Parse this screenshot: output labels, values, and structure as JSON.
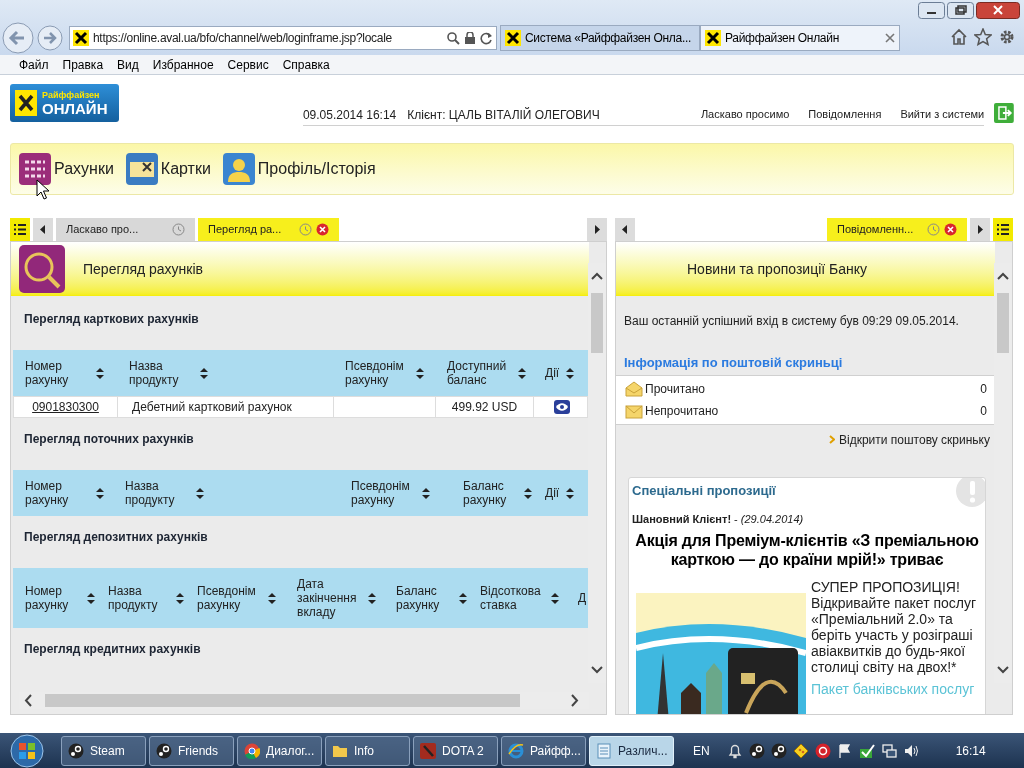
{
  "browser": {
    "address": "https://online.aval.ua/bfo/channel/web/loginframe.jsp?locale",
    "tabs": [
      {
        "label": "Система «Райффайзен Онла...",
        "selected": false
      },
      {
        "label": "Райффайзен Онлайн",
        "selected": true
      }
    ],
    "menu": [
      "Файл",
      "Правка",
      "Вид",
      "Избранное",
      "Сервис",
      "Справка"
    ]
  },
  "logo": {
    "line1": "Райффайзен",
    "line2": "ОНЛАЙН"
  },
  "header": {
    "date": "09.05.2014 16:14",
    "client": "Клієнт: ЦАЛЬ ВІТАЛІЙ ОЛЕГОВИЧ",
    "links": [
      "Ласкаво просимо",
      "Повідомлення",
      "Вийти з системи"
    ]
  },
  "nav": [
    {
      "label": "Рахунки",
      "kind": "accounts"
    },
    {
      "label": "Картки",
      "kind": "cards"
    },
    {
      "label": "Профіль/Історія",
      "kind": "profile"
    }
  ],
  "left_panel": {
    "tabs": [
      {
        "label": "Ласкаво про...",
        "selected": false
      },
      {
        "label": "Перегляд ра...",
        "selected": true
      }
    ],
    "title": "Перегляд рахунків",
    "sections": [
      {
        "kind": "card",
        "title": "Перегляд карткових рахунків",
        "columns": [
          "Номер рахунку",
          "Назва продукту",
          "Псевдонім рахунку",
          "Доступний баланс",
          "Дії"
        ],
        "rows": [
          {
            "number": "0901830300",
            "product": "Дебетний картковий рахунок",
            "balance": "499.92 USD"
          }
        ]
      },
      {
        "kind": "current",
        "title": "Перегляд поточних рахунків",
        "columns": [
          "Номер рахунку",
          "Назва продукту",
          "Псевдонім рахунку",
          "Баланс рахунку",
          "Дії"
        ]
      },
      {
        "kind": "deposit",
        "title": "Перегляд депозитних рахунків",
        "columns": [
          "Номер рахунку",
          "Назва продукту",
          "Псевдонім рахунку",
          "Дата закінчення вкладу",
          "Баланс рахунку",
          "Відсоткова ставка",
          "Д"
        ]
      },
      {
        "kind": "credit",
        "title": "Перегляд кредитних рахунків"
      }
    ]
  },
  "right_panel": {
    "tabs": [
      {
        "label": "Повідомленн...",
        "selected": true
      }
    ],
    "title": "Новини та пропозиції Банку",
    "last_login": "Ваш останній успішний вхід в систему був 09:29 09.05.2014.",
    "mailbox": {
      "title": "Інформація по поштовій скриньці",
      "rows": [
        {
          "kind": "read",
          "label": "Прочитано",
          "count": "0"
        },
        {
          "kind": "unread",
          "label": "Непрочитано",
          "count": "0"
        }
      ],
      "link": "Відкрити поштову скриньку"
    },
    "offers": {
      "title": "Спеціальні пропозиції",
      "greeting": "**Шановний Клієнт!** - *(29.04.2014)*",
      "headline": "Акція для Преміум-клієнтів «З преміальною карткою — до країни мрій!» триває",
      "body": "СУПЕР ПРОПОЗИЦІЯ! Відкривайте пакет послуг «Преміальний 2.0» та беріть участь у розіграші авіаквитків до будь-якої столиці світу на двох!*",
      "link": "Пакет банківських послуг"
    }
  },
  "taskbar": {
    "items": [
      {
        "kind": "steam",
        "label": "Steam",
        "selected": false
      },
      {
        "kind": "steam",
        "label": "Friends",
        "selected": false
      },
      {
        "kind": "chrome",
        "label": "Диалог...",
        "selected": false
      },
      {
        "kind": "folder",
        "label": "Info",
        "selected": false
      },
      {
        "kind": "dota",
        "label": "DOTA 2",
        "selected": false
      },
      {
        "kind": "ie",
        "label": "Райфф...",
        "selected": false
      },
      {
        "kind": "notepad",
        "label": "Различ...",
        "selected": true
      }
    ],
    "language": "EN",
    "clock": "16:14"
  }
}
